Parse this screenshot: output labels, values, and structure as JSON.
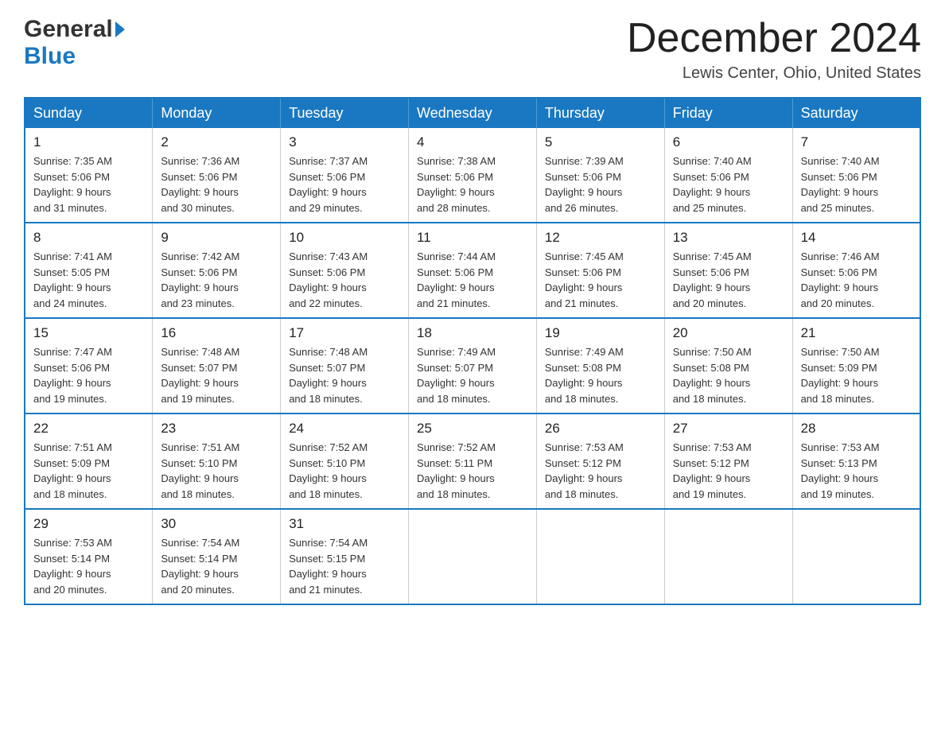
{
  "header": {
    "logo_general": "General",
    "logo_blue": "Blue",
    "title": "December 2024",
    "subtitle": "Lewis Center, Ohio, United States"
  },
  "days_header": [
    "Sunday",
    "Monday",
    "Tuesday",
    "Wednesday",
    "Thursday",
    "Friday",
    "Saturday"
  ],
  "weeks": [
    [
      {
        "day": "1",
        "sunrise": "7:35 AM",
        "sunset": "5:06 PM",
        "daylight": "9 hours and 31 minutes."
      },
      {
        "day": "2",
        "sunrise": "7:36 AM",
        "sunset": "5:06 PM",
        "daylight": "9 hours and 30 minutes."
      },
      {
        "day": "3",
        "sunrise": "7:37 AM",
        "sunset": "5:06 PM",
        "daylight": "9 hours and 29 minutes."
      },
      {
        "day": "4",
        "sunrise": "7:38 AM",
        "sunset": "5:06 PM",
        "daylight": "9 hours and 28 minutes."
      },
      {
        "day": "5",
        "sunrise": "7:39 AM",
        "sunset": "5:06 PM",
        "daylight": "9 hours and 26 minutes."
      },
      {
        "day": "6",
        "sunrise": "7:40 AM",
        "sunset": "5:06 PM",
        "daylight": "9 hours and 25 minutes."
      },
      {
        "day": "7",
        "sunrise": "7:40 AM",
        "sunset": "5:06 PM",
        "daylight": "9 hours and 25 minutes."
      }
    ],
    [
      {
        "day": "8",
        "sunrise": "7:41 AM",
        "sunset": "5:05 PM",
        "daylight": "9 hours and 24 minutes."
      },
      {
        "day": "9",
        "sunrise": "7:42 AM",
        "sunset": "5:06 PM",
        "daylight": "9 hours and 23 minutes."
      },
      {
        "day": "10",
        "sunrise": "7:43 AM",
        "sunset": "5:06 PM",
        "daylight": "9 hours and 22 minutes."
      },
      {
        "day": "11",
        "sunrise": "7:44 AM",
        "sunset": "5:06 PM",
        "daylight": "9 hours and 21 minutes."
      },
      {
        "day": "12",
        "sunrise": "7:45 AM",
        "sunset": "5:06 PM",
        "daylight": "9 hours and 21 minutes."
      },
      {
        "day": "13",
        "sunrise": "7:45 AM",
        "sunset": "5:06 PM",
        "daylight": "9 hours and 20 minutes."
      },
      {
        "day": "14",
        "sunrise": "7:46 AM",
        "sunset": "5:06 PM",
        "daylight": "9 hours and 20 minutes."
      }
    ],
    [
      {
        "day": "15",
        "sunrise": "7:47 AM",
        "sunset": "5:06 PM",
        "daylight": "9 hours and 19 minutes."
      },
      {
        "day": "16",
        "sunrise": "7:48 AM",
        "sunset": "5:07 PM",
        "daylight": "9 hours and 19 minutes."
      },
      {
        "day": "17",
        "sunrise": "7:48 AM",
        "sunset": "5:07 PM",
        "daylight": "9 hours and 18 minutes."
      },
      {
        "day": "18",
        "sunrise": "7:49 AM",
        "sunset": "5:07 PM",
        "daylight": "9 hours and 18 minutes."
      },
      {
        "day": "19",
        "sunrise": "7:49 AM",
        "sunset": "5:08 PM",
        "daylight": "9 hours and 18 minutes."
      },
      {
        "day": "20",
        "sunrise": "7:50 AM",
        "sunset": "5:08 PM",
        "daylight": "9 hours and 18 minutes."
      },
      {
        "day": "21",
        "sunrise": "7:50 AM",
        "sunset": "5:09 PM",
        "daylight": "9 hours and 18 minutes."
      }
    ],
    [
      {
        "day": "22",
        "sunrise": "7:51 AM",
        "sunset": "5:09 PM",
        "daylight": "9 hours and 18 minutes."
      },
      {
        "day": "23",
        "sunrise": "7:51 AM",
        "sunset": "5:10 PM",
        "daylight": "9 hours and 18 minutes."
      },
      {
        "day": "24",
        "sunrise": "7:52 AM",
        "sunset": "5:10 PM",
        "daylight": "9 hours and 18 minutes."
      },
      {
        "day": "25",
        "sunrise": "7:52 AM",
        "sunset": "5:11 PM",
        "daylight": "9 hours and 18 minutes."
      },
      {
        "day": "26",
        "sunrise": "7:53 AM",
        "sunset": "5:12 PM",
        "daylight": "9 hours and 18 minutes."
      },
      {
        "day": "27",
        "sunrise": "7:53 AM",
        "sunset": "5:12 PM",
        "daylight": "9 hours and 19 minutes."
      },
      {
        "day": "28",
        "sunrise": "7:53 AM",
        "sunset": "5:13 PM",
        "daylight": "9 hours and 19 minutes."
      }
    ],
    [
      {
        "day": "29",
        "sunrise": "7:53 AM",
        "sunset": "5:14 PM",
        "daylight": "9 hours and 20 minutes."
      },
      {
        "day": "30",
        "sunrise": "7:54 AM",
        "sunset": "5:14 PM",
        "daylight": "9 hours and 20 minutes."
      },
      {
        "day": "31",
        "sunrise": "7:54 AM",
        "sunset": "5:15 PM",
        "daylight": "9 hours and 21 minutes."
      },
      null,
      null,
      null,
      null
    ]
  ],
  "labels": {
    "sunrise": "Sunrise:",
    "sunset": "Sunset:",
    "daylight": "Daylight:"
  }
}
